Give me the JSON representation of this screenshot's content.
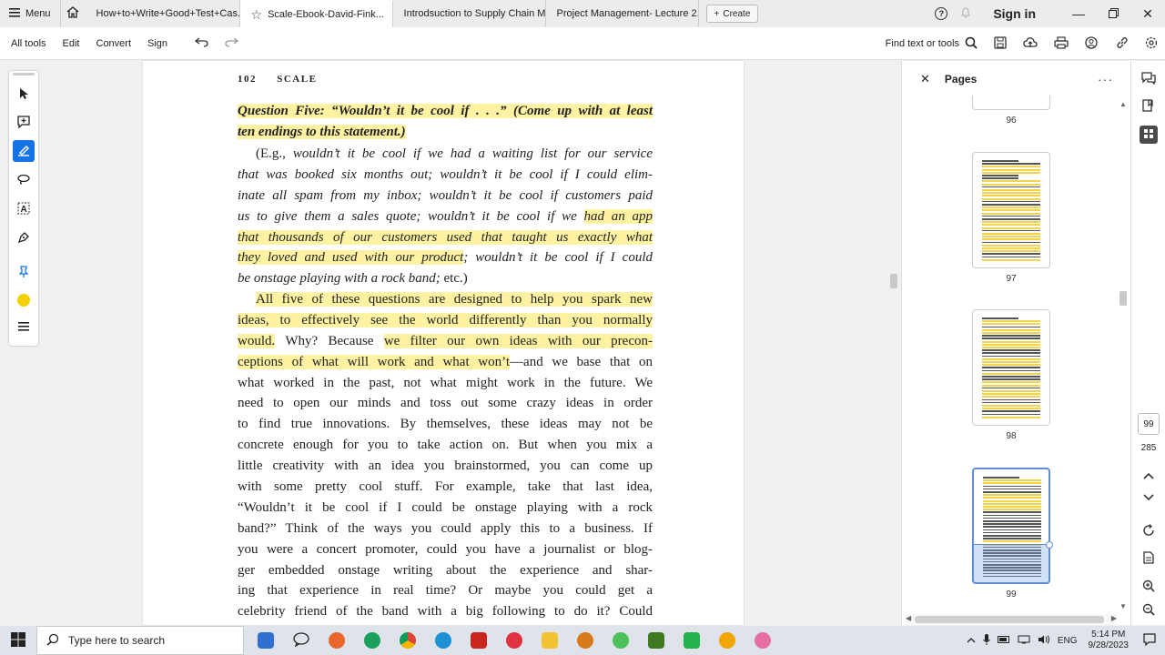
{
  "tabbar": {
    "menu_label": "Menu",
    "tabs": [
      {
        "label": "How+to+Write+Good+Test+Cas...",
        "active": false
      },
      {
        "label": "Scale-Ebook-David-Fink...",
        "active": true
      },
      {
        "label": "Introdsuction to Supply Chain M...",
        "active": false
      },
      {
        "label": "Project Management- Lecture 2...",
        "active": false
      }
    ],
    "create_label": "Create",
    "sign_in_label": "Sign in"
  },
  "toolbar": {
    "items": [
      "All tools",
      "Edit",
      "Convert",
      "Sign"
    ],
    "find_label": "Find text or tools"
  },
  "document": {
    "page_number": "102",
    "running_head": "SCALE",
    "question_lines": [
      "Question Five: “Wouldn’t it be cool if . . .” (Come up with at least",
      "ten endings to this statement.)"
    ],
    "example_lines": [
      {
        "pre": "(E.g., ",
        "it": "wouldn’t it be cool if we had a waiting list for our service"
      },
      {
        "it": "that was booked six months out; wouldn’t it be cool if I could elim-"
      },
      {
        "it": "inate all spam from my inbox; wouldn’t it be cool if customers paid"
      },
      {
        "it": "us to give them a sales quote; wouldn’t it be cool if we ",
        "hl_it": "had an app"
      },
      {
        "hl_it": "that thousands of our customers used that taught us exactly what"
      },
      {
        "hl_it": "they loved and used with our product",
        "it_after": "; wouldn’t it be cool if I could"
      },
      {
        "it": "be onstage playing with a rock band;",
        "post": " etc.)"
      }
    ],
    "body_lines": [
      {
        "hl": "All five of these questions are designed to help you spark new",
        "indent": true
      },
      {
        "hl": "ideas, to effectively see the world differently than you normally"
      },
      {
        "hl": "would.",
        "plain": " Why? Because ",
        "hl2": "we filter our own ideas with our precon-"
      },
      {
        "hl": "ceptions of what will work and what won’t",
        "plain": "—and we base that on"
      },
      {
        "plain": "what worked in the past, not what might work in the future. We"
      },
      {
        "plain": "need to open our minds and toss out some crazy ideas in order"
      },
      {
        "plain": "to find true innovations. By themselves, these ideas may not be"
      },
      {
        "plain": "concrete enough for you to take action on. But when you mix a"
      },
      {
        "plain": "little creativity with an idea you brainstormed, you can come up"
      },
      {
        "plain": "with some pretty cool stuff. For example, take that last idea,"
      },
      {
        "plain": "“Wouldn’t it be cool if I could be onstage playing with a rock"
      },
      {
        "plain": "band?” Think of the ways you could apply this to a business. If"
      },
      {
        "plain": "you were a concert promoter, could you have a journalist or blog-"
      },
      {
        "plain": "ger embedded onstage writing about the experience and shar-"
      },
      {
        "plain": "ing that experience in real time? Or maybe you could get a"
      },
      {
        "plain": "celebrity friend of the band with a big following to do it? Could"
      }
    ]
  },
  "pages_panel": {
    "title": "Pages",
    "thumbnails": [
      {
        "label": "96",
        "selected": false
      },
      {
        "label": "97",
        "selected": false
      },
      {
        "label": "98",
        "selected": false
      },
      {
        "label": "99",
        "selected": true
      }
    ]
  },
  "navigation": {
    "current_page": "99",
    "total_pages": "285"
  },
  "taskbar": {
    "search_placeholder": "Type here to search",
    "language": "ENG",
    "time": "5:14 PM",
    "date": "9/28/2023"
  },
  "colors": {
    "highlight": "#fff3a3",
    "accent": "#1473e6",
    "selection": "#5c8fd6"
  }
}
